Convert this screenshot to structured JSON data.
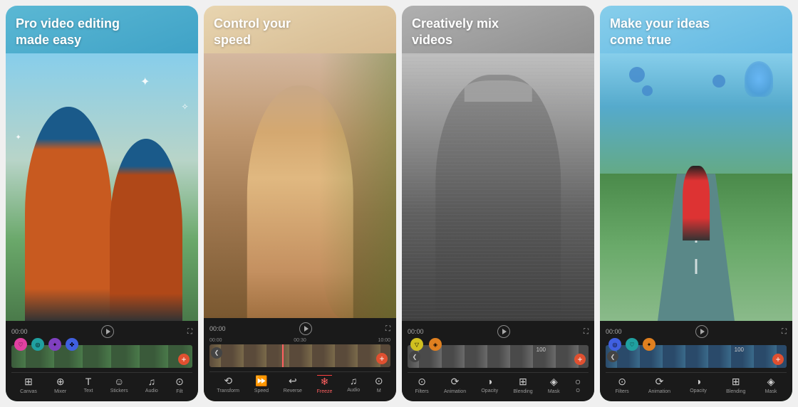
{
  "cards": [
    {
      "id": "card-1",
      "title": "Pro video editing\nmade easy",
      "titleColor": "#ffffff",
      "timeLabel": "00:00",
      "tools": [
        "Canvas",
        "Mixer",
        "Text",
        "Stickers",
        "Audio",
        "Filt"
      ],
      "keyframes": [
        {
          "color": "kf-pink",
          "icon": "♡"
        },
        {
          "color": "kf-teal",
          "icon": "◎"
        },
        {
          "color": "kf-purple",
          "icon": "✦"
        },
        {
          "color": "kf-blue",
          "icon": "✤"
        }
      ]
    },
    {
      "id": "card-2",
      "title": "Control your\nspeed",
      "titleColor": "#ffffff",
      "timeLabel": "00:00",
      "tools": [
        "Transform",
        "Speed",
        "Reverse",
        "Freeze",
        "Audio",
        "M"
      ],
      "timeMarkers": [
        "00:00",
        "00:30",
        "10:00"
      ]
    },
    {
      "id": "card-3",
      "title": "Creatively mix\nvideos",
      "titleColor": "#ffffff",
      "timeLabel": "00:00",
      "tools": [
        "Filters",
        "Animation",
        "Opacity",
        "Blending",
        "Mask",
        "O"
      ],
      "keyframes": [
        {
          "color": "kf-yellow",
          "icon": "▽"
        },
        {
          "color": "kf-orange",
          "icon": "◈"
        }
      ],
      "opacityValue": "100"
    },
    {
      "id": "card-4",
      "title": "Make your ideas\ncome true",
      "titleColor": "#ffffff",
      "timeLabel": "00:00",
      "tools": [
        "Filters",
        "Animation",
        "Opacity",
        "Blending",
        "Mask"
      ],
      "keyframes": [
        {
          "color": "kf-blue",
          "icon": "◎"
        },
        {
          "color": "kf-teal",
          "icon": "♡"
        },
        {
          "color": "kf-orange",
          "icon": "✦"
        }
      ],
      "opacityValue": "100"
    }
  ]
}
